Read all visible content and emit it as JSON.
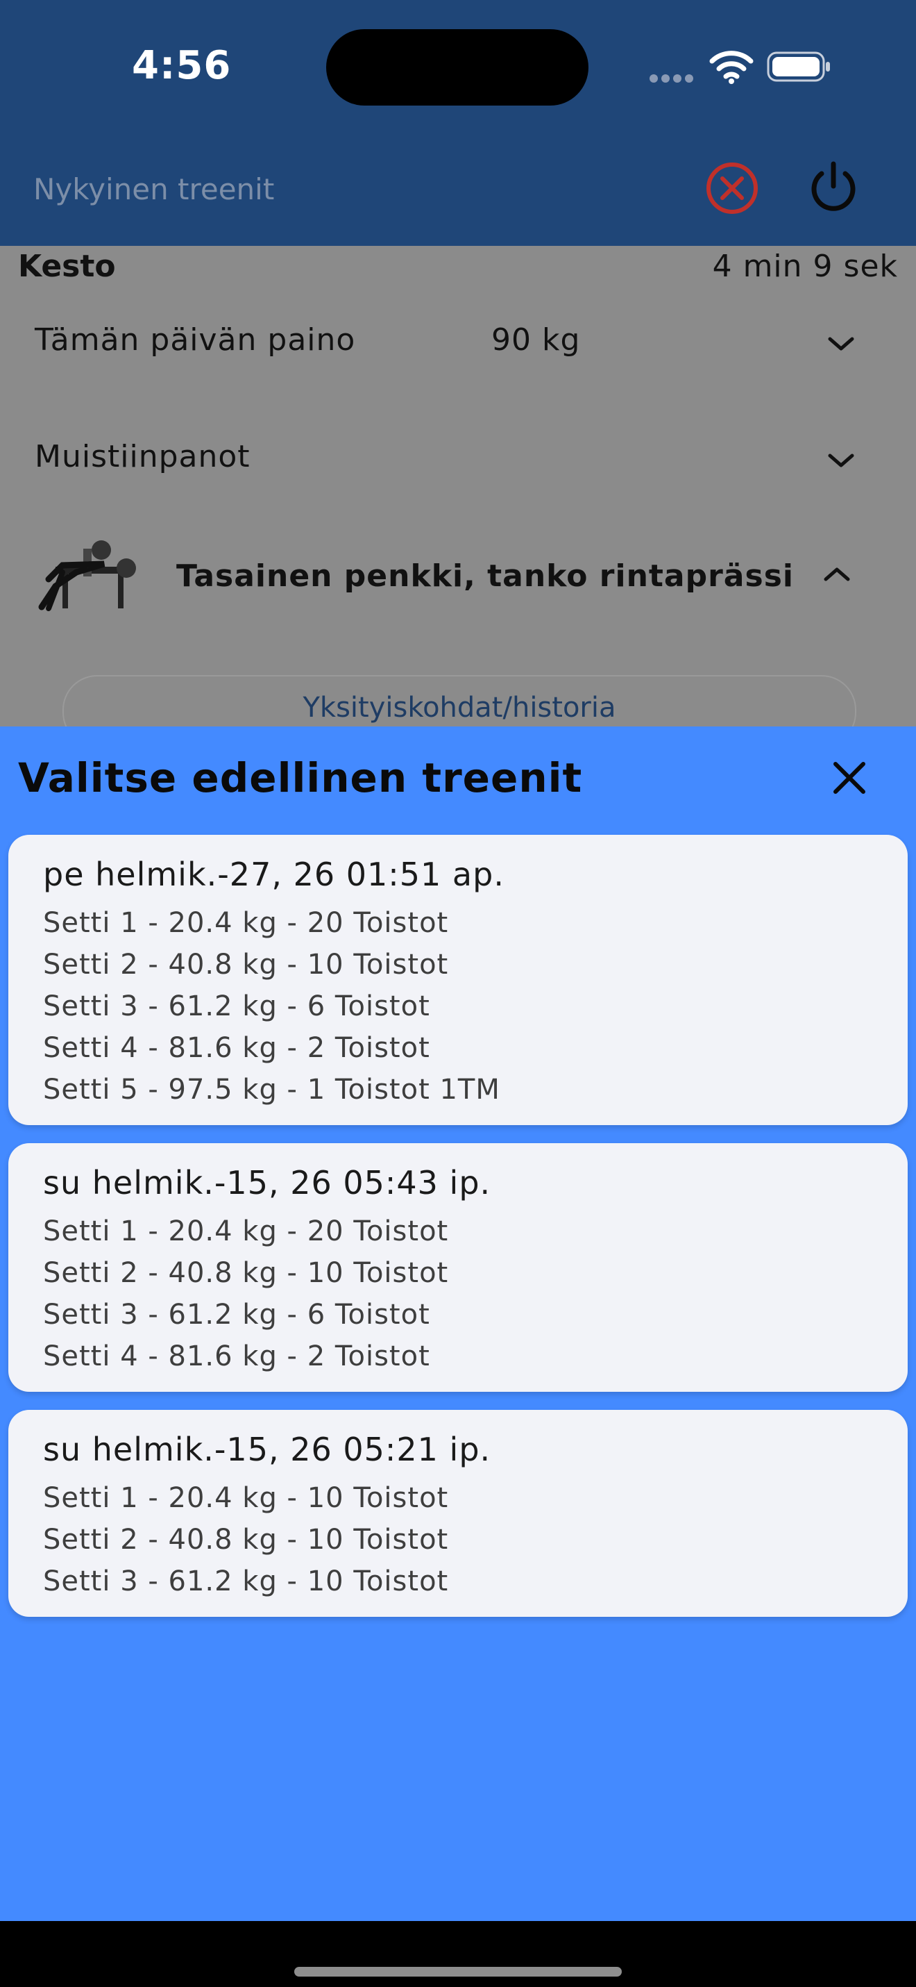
{
  "status_bar": {
    "time": "4:56"
  },
  "app_bar": {
    "title": "Nykyinen treenit"
  },
  "background": {
    "duration_label": "Kesto",
    "duration_value": "4 min 9 sek",
    "weight_row": {
      "label": "Tämän päivän paino",
      "value": "90 kg"
    },
    "notes_row": {
      "label": "Muistiinpanot"
    },
    "exercise": {
      "name": "Tasainen penkki, tanko rintaprässi"
    },
    "details_button": "Yksityiskohdat/historia"
  },
  "sheet": {
    "title": "Valitse edellinen treenit",
    "workouts": [
      {
        "date": "pe helmik.-27, 26 01:51 ap.",
        "sets": [
          "Setti 1 - 20.4 kg - 20 Toistot",
          "Setti 2 - 40.8 kg - 10 Toistot",
          "Setti 3 - 61.2 kg - 6 Toistot",
          "Setti 4 - 81.6 kg - 2 Toistot",
          "Setti 5 - 97.5 kg - 1 Toistot 1TM"
        ]
      },
      {
        "date": "su helmik.-15, 26 05:43 ip.",
        "sets": [
          "Setti 1 - 20.4 kg - 20 Toistot",
          "Setti 2 - 40.8 kg - 10 Toistot",
          "Setti 3 - 61.2 kg - 6 Toistot",
          "Setti 4 - 81.6 kg - 2 Toistot"
        ]
      },
      {
        "date": "su helmik.-15, 26 05:21 ip.",
        "sets": [
          "Setti 1 - 20.4 kg - 10 Toistot",
          "Setti 2 - 40.8 kg - 10 Toistot",
          "Setti 3 - 61.2 kg - 10 Toistot"
        ]
      }
    ]
  },
  "colors": {
    "app_bar": "#1f4678",
    "sheet": "#448aff",
    "card": "#f2f3f8",
    "scrim": "#8b8b8b",
    "cancel_icon": "#c0302a"
  },
  "icons": [
    "wifi-icon",
    "battery-icon",
    "cancel-icon",
    "power-icon",
    "chevron-down-icon",
    "chevron-up-icon",
    "close-icon"
  ]
}
